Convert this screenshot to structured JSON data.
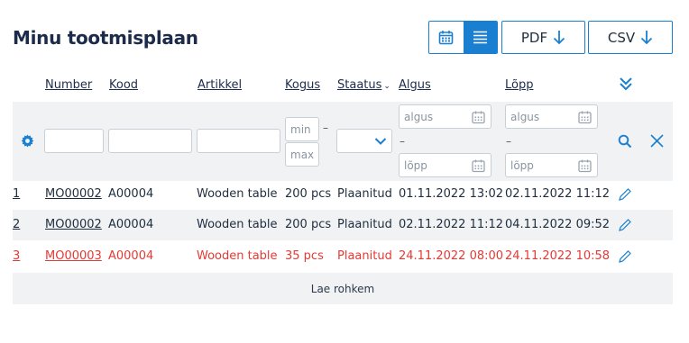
{
  "page": {
    "title": "Minu tootmisplaan"
  },
  "toolbar": {
    "calendar_view_icon": "calendar-icon",
    "list_view_icon": "list-icon",
    "pdf_label": "PDF",
    "csv_label": "CSV",
    "download_icon": "arrow-down-icon",
    "accent_color": "#1a7fd0"
  },
  "table": {
    "headers": {
      "number": "Number",
      "kood": "Kood",
      "artikkel": "Artikkel",
      "kogus": "Kogus",
      "staatus": "Staatus",
      "algus": "Algus",
      "lopp": "Lõpp"
    },
    "filters": {
      "min_placeholder": "min",
      "max_placeholder": "max",
      "range_dash": "–",
      "algus_from": "algus",
      "algus_to": "lõpp",
      "lopp_from": "algus",
      "lopp_to": "lõpp"
    },
    "rows": [
      {
        "index": "1",
        "number": "MO00002",
        "kood": "A00004",
        "artikkel": "Wooden table",
        "kogus": "200 pcs",
        "staatus": "Plaanitud",
        "algus": "01.11.2022 13:02",
        "lopp": "02.11.2022 11:12"
      },
      {
        "index": "2",
        "number": "MO00002",
        "kood": "A00004",
        "artikkel": "Wooden table",
        "kogus": "200 pcs",
        "staatus": "Plaanitud",
        "algus": "02.11.2022 11:12",
        "lopp": "04.11.2022 09:52"
      },
      {
        "index": "3",
        "number": "MO00003",
        "kood": "A00004",
        "artikkel": "Wooden table",
        "kogus": "35 pcs",
        "staatus": "Plaanitud",
        "algus": "24.11.2022 08:00",
        "lopp": "24.11.2022 10:58"
      }
    ],
    "highlight_color": "#e53935",
    "load_more": "Lae rohkem"
  }
}
